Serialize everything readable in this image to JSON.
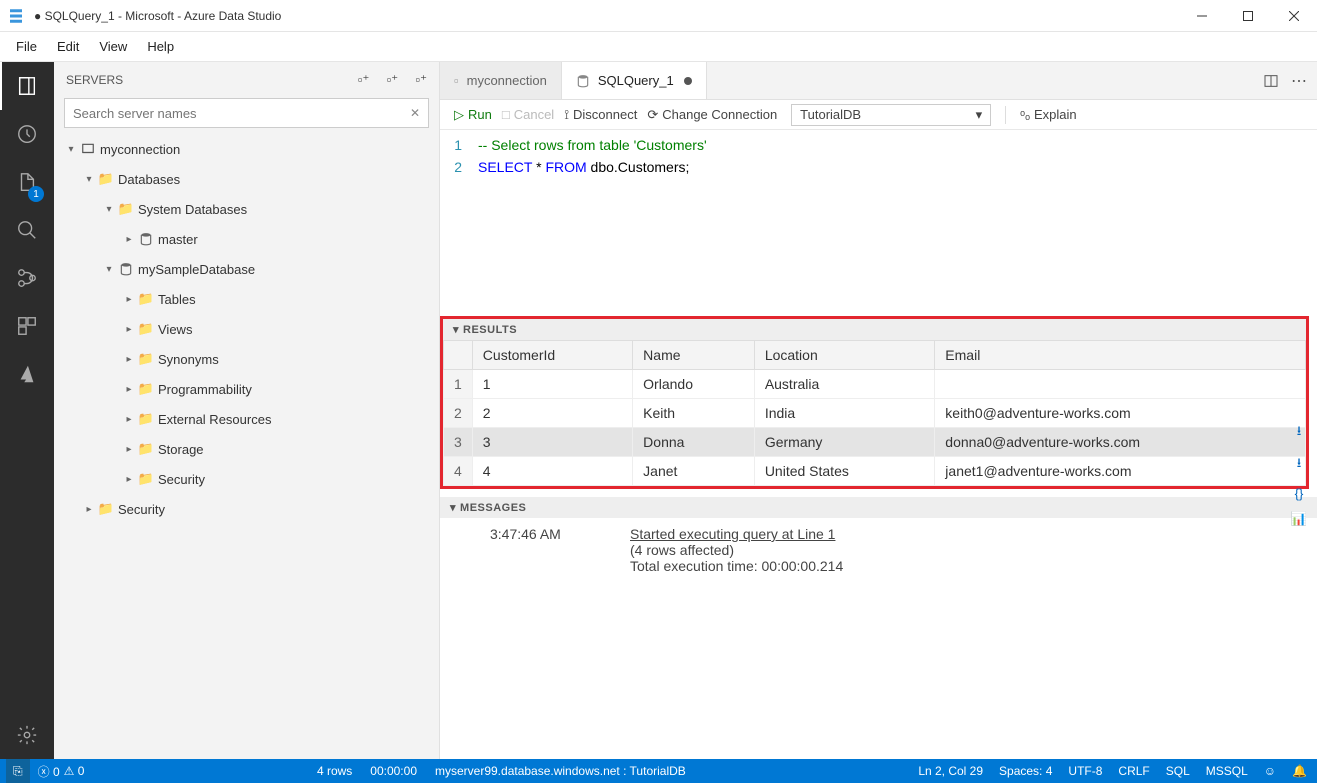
{
  "window": {
    "title": "● SQLQuery_1 - Microsoft - Azure Data Studio"
  },
  "menubar": [
    "File",
    "Edit",
    "View",
    "Help"
  ],
  "sidebar": {
    "title": "SERVERS",
    "search_placeholder": "Search server names",
    "tree": {
      "connection": "myconnection",
      "databases_label": "Databases",
      "system_db_label": "System Databases",
      "master_label": "master",
      "sample_db": "mySampleDatabase",
      "folders": [
        "Tables",
        "Views",
        "Synonyms",
        "Programmability",
        "External Resources",
        "Storage",
        "Security"
      ],
      "root_security": "Security"
    }
  },
  "tabs": [
    {
      "label": "myconnection",
      "active": false
    },
    {
      "label": "SQLQuery_1",
      "active": true,
      "dirty": true
    }
  ],
  "toolbar": {
    "run": "Run",
    "cancel": "Cancel",
    "disconnect": "Disconnect",
    "change_connection": "Change Connection",
    "database": "TutorialDB",
    "explain": "Explain"
  },
  "code": {
    "line1": "-- Select rows from table 'Customers'",
    "line2_select": "SELECT",
    "line2_star": " * ",
    "line2_from": "FROM",
    "line2_rest": " dbo.Customers;"
  },
  "results": {
    "header": "RESULTS",
    "columns": [
      "CustomerId",
      "Name",
      "Location",
      "Email"
    ],
    "rows": [
      [
        "1",
        "Orlando",
        "Australia",
        ""
      ],
      [
        "2",
        "Keith",
        "India",
        "keith0@adventure-works.com"
      ],
      [
        "3",
        "Donna",
        "Germany",
        "donna0@adventure-works.com"
      ],
      [
        "4",
        "Janet",
        "United States",
        "janet1@adventure-works.com"
      ]
    ]
  },
  "messages": {
    "header": "MESSAGES",
    "time": "3:47:46 AM",
    "line1": "Started executing query at Line 1",
    "line2": "(4 rows affected)",
    "line3": "Total execution time: 00:00:00.214"
  },
  "statusbar": {
    "errors": "0",
    "warnings": "0",
    "rows": "4 rows",
    "elapsed": "00:00:00",
    "server": "myserver99.database.windows.net : TutorialDB",
    "cursor": "Ln 2, Col 29",
    "spaces": "Spaces: 4",
    "encoding": "UTF-8",
    "eol": "CRLF",
    "lang": "SQL",
    "conn": "MSSQL"
  },
  "activity_badge": "1"
}
